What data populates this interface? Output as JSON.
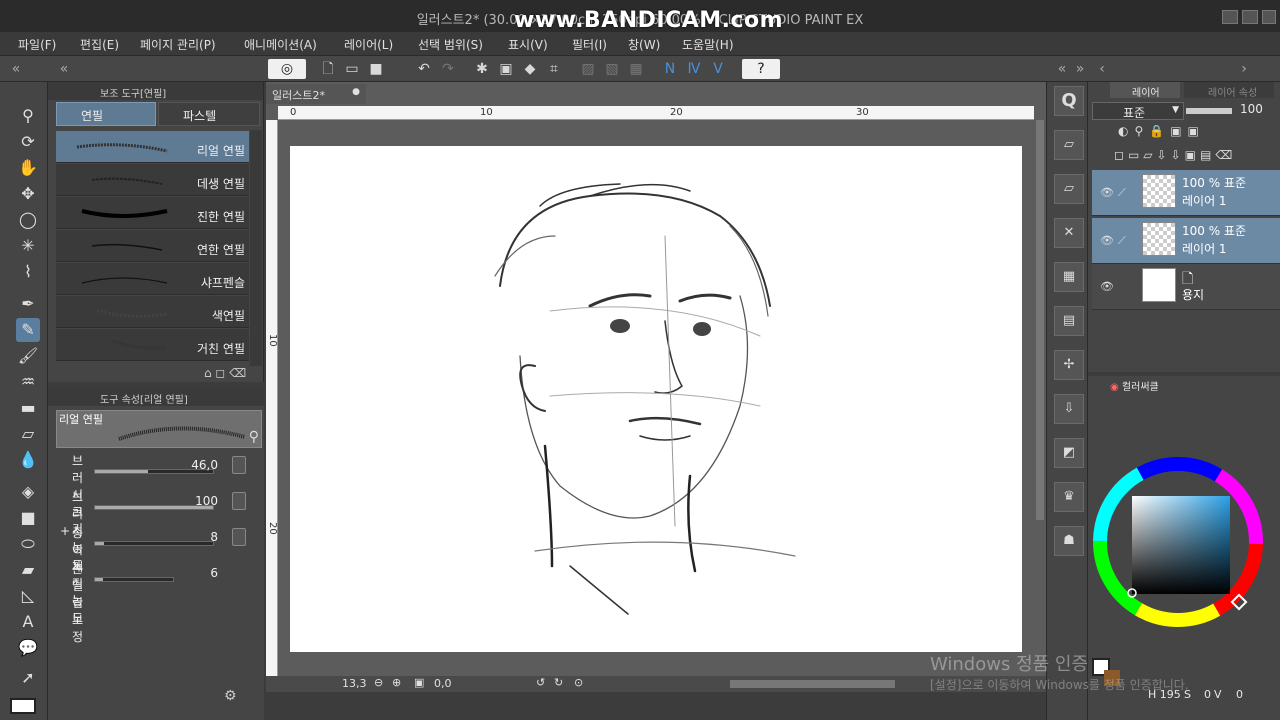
{
  "window": {
    "title": "일러스트2* (30.00 ×27.00cm 350dpi 60.00%) - CLIP STUDIO PAINT EX",
    "watermark": "www.BANDICAM.com"
  },
  "menu": [
    "파일(F)",
    "편집(E)",
    "페이지 관리(P)",
    "애니메이션(A)",
    "레이어(L)",
    "선택 범위(S)",
    "표시(V)",
    "필터(I)",
    "창(W)",
    "도움말(H)"
  ],
  "subtool": {
    "header": "보조 도구[연필]",
    "tabs": [
      "연필",
      "파스텔"
    ],
    "brushes": [
      "리얼 연필",
      "데생 연필",
      "진한 연필",
      "연한 연필",
      "샤프펜슬",
      "색연필",
      "거친 연필"
    ],
    "selected_index": 0
  },
  "toolprop": {
    "header": "도구 속성[리얼 연필]",
    "preview_label": "리얼 연필",
    "props": [
      {
        "label": "브러시 크기",
        "value": "46,0",
        "fill": 0.45
      },
      {
        "label": "브러시 농도",
        "value": "100",
        "fill": 1.0
      },
      {
        "label": "종이 재질 농도",
        "value": "8",
        "fill": 0.08
      },
      {
        "label": "손떨림 보정",
        "value": "6",
        "fill": 0.1
      }
    ]
  },
  "canvas": {
    "doc_tab": "일러스트2*",
    "ruler_h": [
      "0",
      "10",
      "20",
      "30"
    ],
    "ruler_v": [
      "10",
      "20"
    ],
    "zoom": "13,3",
    "rotation": "0,0"
  },
  "layers": {
    "tabs": [
      "레이어",
      "레이어 속성"
    ],
    "blend": "표준",
    "opacity": "100",
    "items": [
      {
        "line1": "100 % 표준",
        "line2": "레이어 1",
        "selected": true,
        "transparent": true
      },
      {
        "line1": "100 % 표준",
        "line2": "레이어 1",
        "selected": true,
        "transparent": true
      },
      {
        "line1": "",
        "line2": "용지",
        "selected": false,
        "transparent": false
      }
    ]
  },
  "color": {
    "header": "컬러써클",
    "h": "195",
    "s": "0",
    "v": "0"
  },
  "os_notice": {
    "line1": "Windows 정품 인증",
    "line2": "[설정]으로 이동하여 Windows를 정품 인증합니다."
  }
}
